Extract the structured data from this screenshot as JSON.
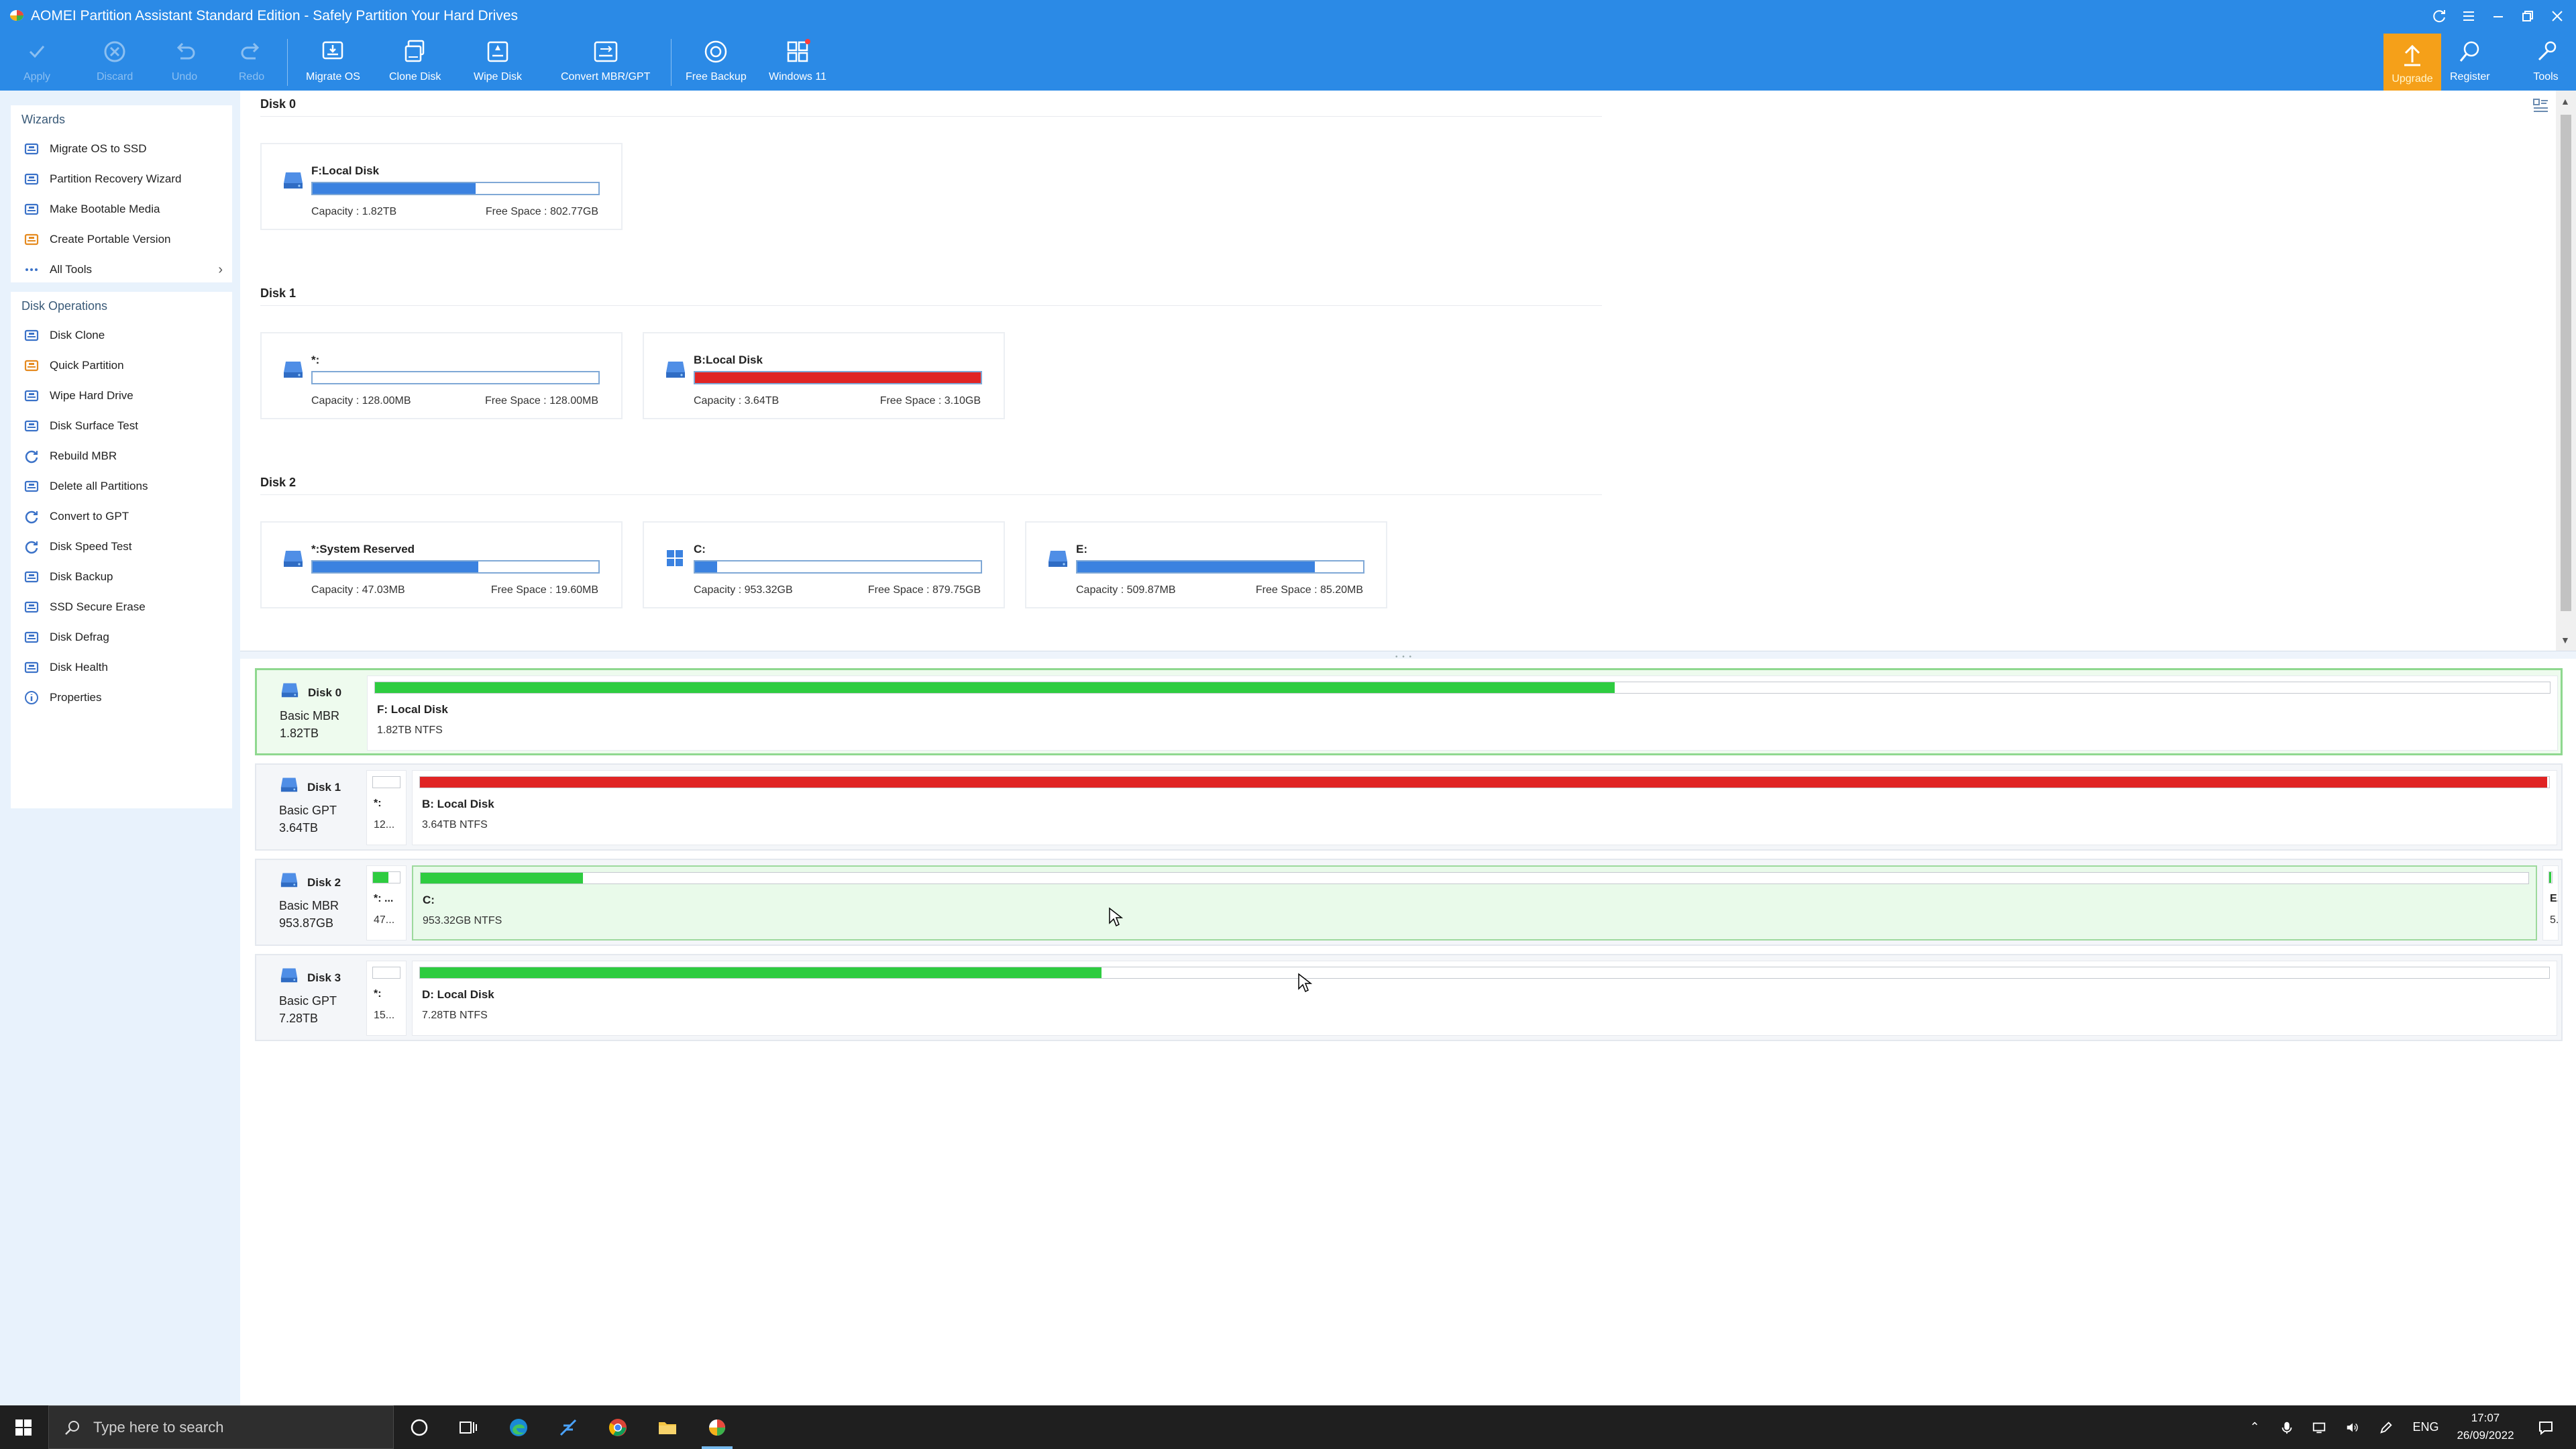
{
  "window": {
    "title": "AOMEI Partition Assistant Standard Edition - Safely Partition Your Hard Drives"
  },
  "toolbar": {
    "apply": "Apply",
    "discard": "Discard",
    "undo": "Undo",
    "redo": "Redo",
    "migrate_os": "Migrate OS",
    "clone_disk": "Clone Disk",
    "wipe_disk": "Wipe Disk",
    "convert_mbr_gpt": "Convert MBR/GPT",
    "free_backup": "Free Backup",
    "windows11": "Windows 11",
    "upgrade": "Upgrade",
    "register": "Register",
    "tools": "Tools"
  },
  "sidebar": {
    "wizards": {
      "title": "Wizards",
      "items": [
        {
          "label": "Migrate OS to SSD",
          "icon": "migrate-icon"
        },
        {
          "label": "Partition Recovery Wizard",
          "icon": "recovery-icon"
        },
        {
          "label": "Make Bootable Media",
          "icon": "bootable-media-icon"
        },
        {
          "label": "Create Portable Version",
          "icon": "portable-icon"
        },
        {
          "label": "All Tools",
          "icon": "more-icon"
        }
      ]
    },
    "disk_operations": {
      "title": "Disk Operations",
      "items": [
        {
          "label": "Disk Clone",
          "icon": "disk-clone-icon"
        },
        {
          "label": "Quick Partition",
          "icon": "quick-partition-icon"
        },
        {
          "label": "Wipe Hard Drive",
          "icon": "wipe-icon"
        },
        {
          "label": "Disk Surface Test",
          "icon": "surface-test-icon"
        },
        {
          "label": "Rebuild MBR",
          "icon": "rebuild-icon"
        },
        {
          "label": "Delete all Partitions",
          "icon": "delete-icon"
        },
        {
          "label": "Convert to GPT",
          "icon": "convert-icon"
        },
        {
          "label": "Disk Speed Test",
          "icon": "speed-icon"
        },
        {
          "label": "Disk Backup",
          "icon": "backup-icon"
        },
        {
          "label": "SSD Secure Erase",
          "icon": "secure-erase-icon"
        },
        {
          "label": "Disk Defrag",
          "icon": "defrag-icon"
        },
        {
          "label": "Disk Health",
          "icon": "health-icon"
        },
        {
          "label": "Properties",
          "icon": "info-icon"
        }
      ]
    }
  },
  "disks_view": {
    "disk0": {
      "label": "Disk 0",
      "cards": [
        {
          "name": "F:Local Disk",
          "capacity": "Capacity : 1.82TB",
          "free": "Free Space : 802.77GB",
          "used_fraction": 0.57,
          "color": "#3b82e0",
          "icon": "drive-icon"
        }
      ]
    },
    "disk1": {
      "label": "Disk 1",
      "cards": [
        {
          "name": "*:",
          "capacity": "Capacity : 128.00MB",
          "free": "Free Space : 128.00MB",
          "used_fraction": 0.0,
          "color": "#3b82e0",
          "icon": "drive-icon"
        },
        {
          "name": "B:Local Disk",
          "capacity": "Capacity : 3.64TB",
          "free": "Free Space : 3.10GB",
          "used_fraction": 0.999,
          "color": "#e02424",
          "icon": "drive-icon"
        }
      ]
    },
    "disk2": {
      "label": "Disk 2",
      "cards": [
        {
          "name": "*:System Reserved",
          "capacity": "Capacity : 47.03MB",
          "free": "Free Space : 19.60MB",
          "used_fraction": 0.58,
          "color": "#3b82e0",
          "icon": "drive-icon"
        },
        {
          "name": "C:",
          "capacity": "Capacity : 953.32GB",
          "free": "Free Space : 879.75GB",
          "used_fraction": 0.077,
          "color": "#3b82e0",
          "icon": "windows-icon"
        },
        {
          "name": "E:",
          "capacity": "Capacity : 509.87MB",
          "free": "Free Space : 85.20MB",
          "used_fraction": 0.83,
          "color": "#3b82e0",
          "icon": "drive-icon"
        }
      ]
    }
  },
  "disk_map": [
    {
      "name": "Disk 0",
      "type": "Basic MBR",
      "size": "1.82TB",
      "partitions": [
        {
          "name": "F: Local Disk",
          "desc": "1.82TB NTFS",
          "used_fraction": 0.57,
          "color": "#2ecc40"
        }
      ]
    },
    {
      "name": "Disk 1",
      "type": "Basic GPT",
      "size": "3.64TB",
      "partitions": [
        {
          "name": "*:",
          "desc": "12...",
          "used_fraction": 0.0,
          "color": "#2ecc40"
        },
        {
          "name": "B: Local Disk",
          "desc": "3.64TB NTFS",
          "used_fraction": 0.999,
          "color": "#e02424"
        }
      ]
    },
    {
      "name": "Disk 2",
      "type": "Basic MBR",
      "size": "953.87GB",
      "partitions": [
        {
          "name": "*: ...",
          "desc": "47...",
          "used_fraction": 0.58,
          "color": "#2ecc40"
        },
        {
          "name": "C:",
          "desc": "953.32GB NTFS",
          "used_fraction": 0.077,
          "color": "#2ecc40"
        },
        {
          "name": "E.",
          "desc": "5.",
          "used_fraction": 0.83,
          "color": "#2ecc40"
        }
      ]
    },
    {
      "name": "Disk 3",
      "type": "Basic GPT",
      "size": "7.28TB",
      "partitions": [
        {
          "name": "*:",
          "desc": "15...",
          "used_fraction": 0.0,
          "color": "#2ecc40"
        },
        {
          "name": "D: Local Disk",
          "desc": "7.28TB NTFS",
          "used_fraction": 0.32,
          "color": "#2ecc40"
        }
      ]
    }
  ],
  "taskbar": {
    "search_placeholder": "Type here to search",
    "language": "ENG",
    "time": "17:07",
    "date": "26/09/2022"
  },
  "colors": {
    "titlebar": "#2b8ae6",
    "upgrade": "#f5a019",
    "sidebar": "#e8f2fc",
    "selected_row": "#eefbee",
    "used_blue": "#3b82e0",
    "used_green": "#2ecc40",
    "used_red": "#e02424"
  }
}
